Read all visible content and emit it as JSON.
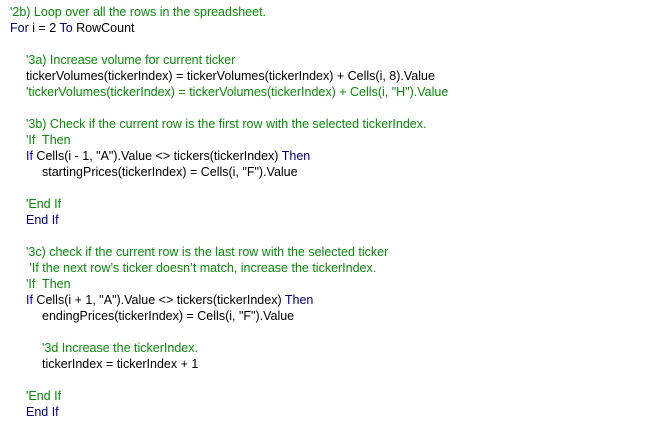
{
  "colors": {
    "comment": "#0a8a0a",
    "keyword": "#000080",
    "text": "#000000",
    "background": "#ffffff"
  },
  "code": {
    "l1": "'2b) Loop over all the rows in the spreadsheet.",
    "l2_kw1": "For",
    "l2_txt": " i = 2 ",
    "l2_kw2": "To",
    "l2_txt2": " RowCount",
    "l3": "'3a) Increase volume for current ticker",
    "l4": "tickerVolumes(tickerIndex) = tickerVolumes(tickerIndex) + Cells(i, 8).Value",
    "l5": "'tickerVolumes(tickerIndex) = tickerVolumes(tickerIndex) + Cells(i, \"H\").Value",
    "l6": "'3b) Check if the current row is the first row with the selected tickerIndex.",
    "l7": "'If  Then",
    "l8_kw1": "If",
    "l8_txt": " Cells(i - 1, \"A\").Value <> tickers(tickerIndex) ",
    "l8_kw2": "Then",
    "l9": "startingPrices(tickerIndex) = Cells(i, \"F\").Value",
    "l10": "'End If",
    "l11": "End If",
    "l12": "'3c) check if the current row is the last row with the selected ticker",
    "l13": " 'If the next row’s ticker doesn’t match, increase the tickerIndex.",
    "l14": "'If  Then",
    "l15_kw1": "If",
    "l15_txt": " Cells(i + 1, \"A\").Value <> tickers(tickerIndex) ",
    "l15_kw2": "Then",
    "l16": "endingPrices(tickerIndex) = Cells(i, \"F\").Value",
    "l17": "'3d Increase the tickerIndex.",
    "l18": "tickerIndex = tickerIndex + 1",
    "l19": "'End If",
    "l20": "End If"
  }
}
